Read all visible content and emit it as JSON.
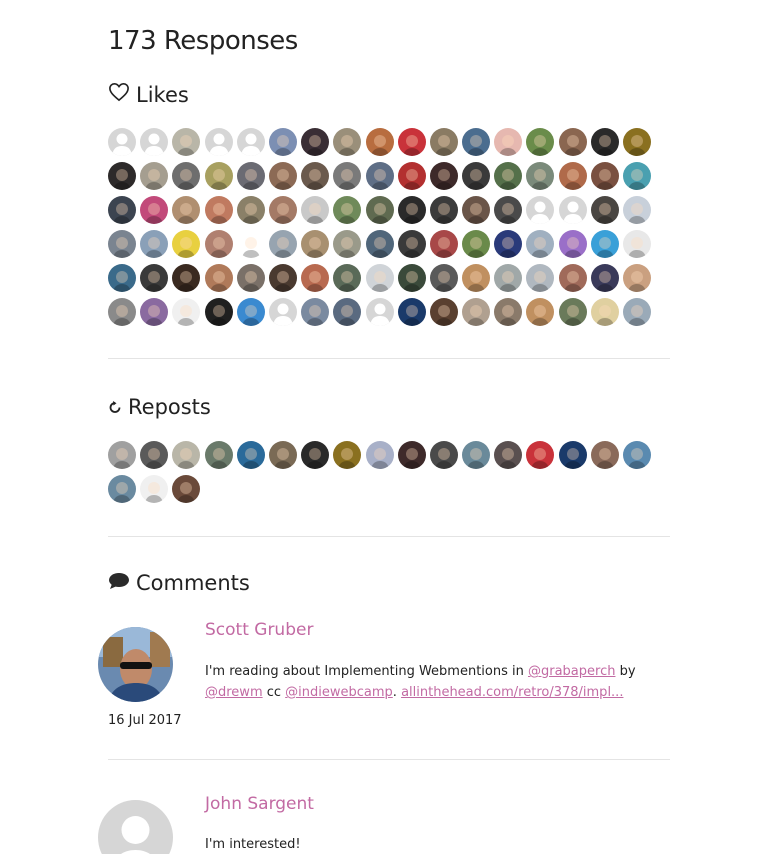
{
  "title": "173 Responses",
  "likes": {
    "heading": "Likes",
    "icon": "heart-outline-icon",
    "colors": [
      "#d6d6d6",
      "#d6d6d6",
      "#b9b6a8",
      "#d6d6d6",
      "#d6d6d6",
      "#7c8fb3",
      "#3a2e35",
      "#9a8f7a",
      "#b86d3f",
      "#c9323a",
      "#8a7b63",
      "#4b6d8f",
      "#e6b8b0",
      "#6a8c4a",
      "#8a6650",
      "#2a2a2a",
      "#8a7020",
      "#2d2a2a",
      "#a59e90",
      "#6e6e6e",
      "#a8a060",
      "#6b6b73",
      "#8c6a55",
      "#6b5a4d",
      "#7a7a7a",
      "#5e6e86",
      "#b33030",
      "#3e2a2a",
      "#3a3a3a",
      "#55704a",
      "#7a8a7a",
      "#b06a4a",
      "#7a5040",
      "#4aa0b0",
      "#3c4450",
      "#c24a7a",
      "#b08f70",
      "#c07a60",
      "#8a8068",
      "#a47a66",
      "#c9c9c9",
      "#6f8a5a",
      "#5f6a50",
      "#2a2a2a",
      "#3b3b3b",
      "#6a5548",
      "#4a4a4a",
      "#d6d6d6",
      "#d6d6d6",
      "#4a4642",
      "#c8d0da",
      "#7a8490",
      "#8aa0b8",
      "#e8d040",
      "#b08070",
      "#ffffff",
      "#97a4b0",
      "#a89070",
      "#9a9a8a",
      "#50667a",
      "#3a3a3a",
      "#a84848",
      "#6a8a4a",
      "#2a3a7a",
      "#a0b0c0",
      "#9a6fc8",
      "#3aa0d8",
      "#e8e8e8",
      "#3a6a8a",
      "#3a3a3a",
      "#3a2a20",
      "#b07a5a",
      "#7a7068",
      "#4a3a30",
      "#b86a50",
      "#5a6a58",
      "#d0d4d8",
      "#3a4a3a",
      "#5a5a5a",
      "#c09060",
      "#a0a8a8",
      "#b0b8c0",
      "#a06a5a",
      "#3a3a5a",
      "#caa080",
      "#8a8a8a",
      "#8a6aa0",
      "#f0f0f0",
      "#202020",
      "#3a8ad0",
      "#d6d6d6",
      "#7a8aa0",
      "#5a6a80",
      "#d6d6d6",
      "#1a3a6a",
      "#5a4030",
      "#b0a090",
      "#8a7a6a",
      "#c09060",
      "#6a7a5a",
      "#e0d0a0",
      "#9aaab8"
    ]
  },
  "reposts": {
    "heading": "Reposts",
    "icon": "repost-arrow-icon",
    "colors": [
      "#a0a0a0",
      "#5a5a5a",
      "#b9b6a8",
      "#6a7a6a",
      "#2a6a9a",
      "#7a6a55",
      "#2a2a2a",
      "#8a7020",
      "#a8b0c8",
      "#3e2a2a",
      "#4a4a4a",
      "#6a8a9a",
      "#5a5050",
      "#c9323a",
      "#1a3a6a",
      "#8a6a5a",
      "#5a8ab0",
      "#6a8aa0",
      "#f0f0f0",
      "#6a4a3a"
    ]
  },
  "comments": {
    "heading": "Comments",
    "icon": "speech-bubble-icon",
    "items": [
      {
        "author": "Scott Gruber",
        "text_before": "I'm reading about Implementing Webmentions in ",
        "mention_1": "@grabaperch",
        "text_by": " by",
        "mention_2": "@drewm",
        "text_cc": " cc ",
        "mention_3": "@indiewebcamp",
        "text_dot": ". ",
        "link": "allinthehead.com/retro/378/impl...",
        "date": "16 Jul 2017"
      },
      {
        "author": "John Sargent",
        "text": "I'm interested!"
      }
    ]
  },
  "colors": {
    "link": "#c26aa3",
    "rule": "#e4e4e4",
    "placeholder": "#d6d6d6"
  }
}
